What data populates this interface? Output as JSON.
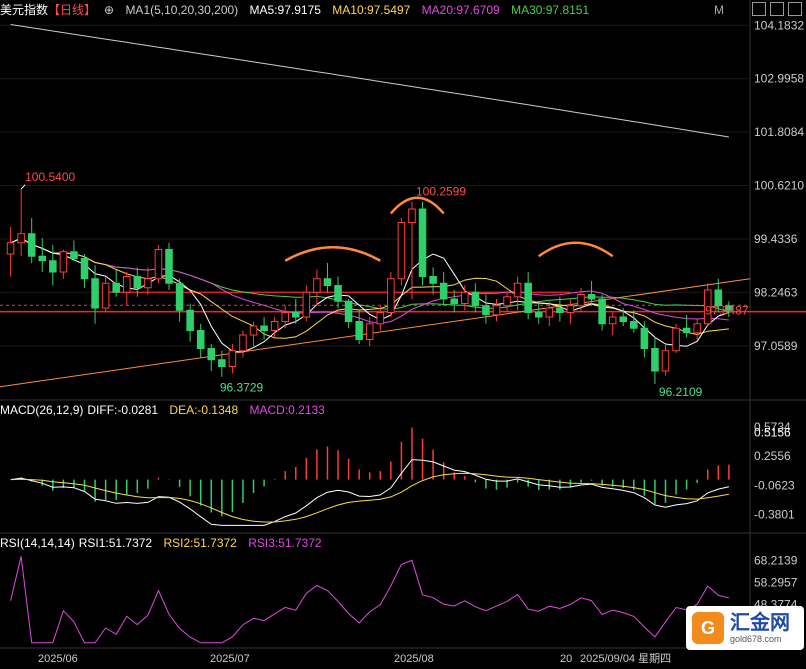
{
  "header": {
    "title": "美元指数",
    "period": "【日线】",
    "ma_label": "MA1(5,10,20,30,200)",
    "ma5": "MA5:97.9175",
    "ma10": "MA10:97.5497",
    "ma20": "MA20:97.6709",
    "ma30": "MA30:97.8151",
    "m": "M"
  },
  "macd_header": {
    "label": "MACD(26,12,9)",
    "diff": "DIFF:-0.0281",
    "dea": "DEA:-0.1348",
    "macd": "MACD:0.2133"
  },
  "rsi_header": {
    "label": "RSI(14,14,14)",
    "rsi1": "RSI1:51.7372",
    "rsi2": "RSI2:51.7372",
    "rsi3": "RSI3:51.7372"
  },
  "colors": {
    "up": "#ff3b3b",
    "down": "#2fcf6a",
    "ma5": "#ffffff",
    "ma10": "#ffd94a",
    "ma20": "#e04ae0",
    "ma30": "#4ad04a",
    "ma200": "#cccccc",
    "trend": "#ff8a3d",
    "level": "#ff2020",
    "diff": "#ffffff",
    "dea": "#ffd94a",
    "rsi": "#e04ae0"
  },
  "chart_data": [
    {
      "type": "candlestick",
      "name": "price",
      "y_ticks": [
        "104.1832",
        "102.9958",
        "101.8084",
        "100.6210",
        "99.4336",
        "98.2463",
        "97.0589"
      ],
      "ylim": [
        95.9,
        104.3
      ],
      "x_ticks": [
        "2025/06",
        "2025/07",
        "2025/08",
        "20",
        "2025/09/04 星期四"
      ],
      "annotations": [
        "100.5400",
        "96.3729",
        "100.2599",
        "96.2109",
        "97.5487"
      ],
      "candles": [
        [
          99.1,
          99.7,
          98.6,
          99.35
        ],
        [
          99.35,
          100.54,
          99.05,
          99.55
        ],
        [
          99.55,
          99.9,
          98.9,
          99.05
        ],
        [
          99.05,
          99.45,
          98.7,
          98.95
        ],
        [
          98.95,
          99.3,
          98.4,
          98.7
        ],
        [
          98.7,
          99.2,
          98.55,
          99.15
        ],
        [
          99.15,
          99.4,
          98.95,
          99.0
        ],
        [
          99.0,
          99.1,
          98.35,
          98.55
        ],
        [
          98.55,
          98.85,
          97.55,
          97.9
        ],
        [
          97.9,
          98.6,
          97.8,
          98.45
        ],
        [
          98.45,
          98.75,
          98.15,
          98.25
        ],
        [
          98.25,
          98.7,
          97.95,
          98.6
        ],
        [
          98.6,
          98.8,
          98.15,
          98.35
        ],
        [
          98.35,
          98.8,
          98.2,
          98.55
        ],
        [
          98.55,
          99.3,
          98.45,
          99.2
        ],
        [
          99.2,
          99.35,
          98.3,
          98.45
        ],
        [
          98.45,
          98.55,
          97.6,
          97.85
        ],
        [
          97.85,
          98.0,
          97.15,
          97.4
        ],
        [
          97.4,
          97.55,
          96.8,
          97.0
        ],
        [
          97.0,
          97.1,
          96.5,
          96.75
        ],
        [
          96.75,
          96.95,
          96.37,
          96.6
        ],
        [
          96.6,
          97.1,
          96.45,
          96.95
        ],
        [
          96.95,
          97.4,
          96.8,
          97.3
        ],
        [
          97.3,
          97.6,
          97.05,
          97.5
        ],
        [
          97.5,
          97.7,
          97.2,
          97.4
        ],
        [
          97.4,
          97.7,
          97.25,
          97.6
        ],
        [
          97.6,
          97.95,
          97.45,
          97.8
        ],
        [
          97.8,
          98.1,
          97.55,
          97.7
        ],
        [
          97.7,
          98.4,
          97.6,
          98.25
        ],
        [
          98.25,
          98.75,
          97.95,
          98.55
        ],
        [
          98.55,
          98.9,
          98.25,
          98.4
        ],
        [
          98.4,
          98.6,
          97.9,
          98.05
        ],
        [
          98.05,
          98.1,
          97.45,
          97.6
        ],
        [
          97.6,
          97.85,
          97.1,
          97.2
        ],
        [
          97.2,
          97.7,
          97.05,
          97.55
        ],
        [
          97.55,
          97.95,
          97.4,
          97.8
        ],
        [
          97.8,
          98.7,
          97.7,
          98.55
        ],
        [
          98.55,
          99.9,
          98.4,
          99.8
        ],
        [
          99.8,
          100.26,
          98.1,
          100.1
        ],
        [
          100.1,
          100.26,
          98.4,
          98.6
        ],
        [
          98.6,
          98.8,
          98.2,
          98.45
        ],
        [
          98.45,
          98.7,
          97.95,
          98.1
        ],
        [
          98.1,
          98.3,
          97.8,
          98.0
        ],
        [
          98.0,
          98.4,
          97.85,
          98.25
        ],
        [
          98.25,
          98.45,
          97.8,
          97.95
        ],
        [
          97.95,
          98.2,
          97.55,
          97.75
        ],
        [
          97.75,
          98.1,
          97.6,
          97.95
        ],
        [
          97.95,
          98.25,
          97.8,
          98.15
        ],
        [
          98.15,
          98.6,
          97.85,
          98.45
        ],
        [
          98.45,
          98.7,
          97.65,
          97.8
        ],
        [
          97.8,
          98.0,
          97.55,
          97.7
        ],
        [
          97.7,
          98.05,
          97.5,
          97.9
        ],
        [
          97.9,
          98.15,
          97.6,
          97.8
        ],
        [
          97.8,
          98.1,
          97.55,
          97.95
        ],
        [
          97.95,
          98.35,
          97.8,
          98.2
        ],
        [
          98.2,
          98.5,
          97.95,
          98.1
        ],
        [
          98.1,
          98.2,
          97.4,
          97.55
        ],
        [
          97.55,
          97.8,
          97.3,
          97.7
        ],
        [
          97.7,
          97.9,
          97.5,
          97.6
        ],
        [
          97.6,
          97.85,
          97.35,
          97.45
        ],
        [
          97.45,
          97.6,
          96.8,
          97.0
        ],
        [
          97.0,
          97.25,
          96.21,
          96.5
        ],
        [
          96.5,
          97.1,
          96.4,
          96.95
        ],
        [
          96.95,
          97.55,
          96.9,
          97.45
        ],
        [
          97.45,
          97.75,
          97.25,
          97.35
        ],
        [
          97.35,
          97.65,
          97.2,
          97.55
        ],
        [
          97.55,
          98.45,
          97.5,
          98.3
        ],
        [
          98.3,
          98.55,
          97.8,
          97.95
        ],
        [
          97.95,
          98.05,
          97.7,
          97.85
        ]
      ]
    },
    {
      "type": "bar",
      "name": "macd",
      "y_ticks": [
        "0.5734",
        "0.5156",
        "0.2556",
        "-0.0623",
        "-0.3801"
      ],
      "ylim": [
        -0.55,
        0.65
      ]
    },
    {
      "type": "line",
      "name": "rsi",
      "y_ticks": [
        "68.2139",
        "58.2957",
        "48.3774"
      ],
      "ylim": [
        30,
        72
      ]
    }
  ],
  "logo": {
    "mark": "G",
    "name": "汇金网",
    "url": "gold678.com"
  }
}
